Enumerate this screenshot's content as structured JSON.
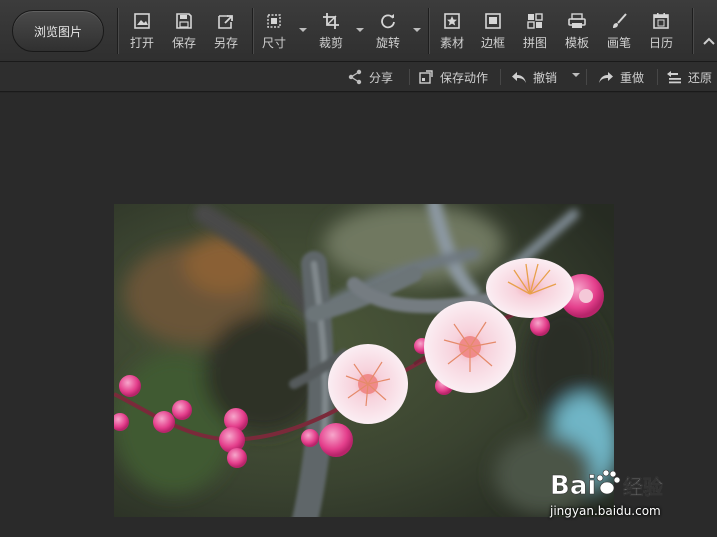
{
  "toolbar": {
    "browse_label": "浏览图片",
    "tools": [
      {
        "label": "打开",
        "icon": "open-icon"
      },
      {
        "label": "保存",
        "icon": "save-icon"
      },
      {
        "label": "另存",
        "icon": "save-as-icon"
      },
      {
        "label": "尺寸",
        "icon": "resize-icon"
      },
      {
        "label": "裁剪",
        "icon": "crop-icon"
      },
      {
        "label": "旋转",
        "icon": "rotate-icon"
      },
      {
        "label": "素材",
        "icon": "sticker-icon"
      },
      {
        "label": "边框",
        "icon": "frame-icon"
      },
      {
        "label": "拼图",
        "icon": "collage-icon"
      },
      {
        "label": "模板",
        "icon": "template-icon"
      },
      {
        "label": "画笔",
        "icon": "brush-icon"
      },
      {
        "label": "日历",
        "icon": "calendar-icon"
      }
    ]
  },
  "actionbar": {
    "share": "分享",
    "save_action": "保存动作",
    "undo": "撤销",
    "redo": "重做",
    "restore": "还原"
  },
  "watermark": {
    "brand": "Bai",
    "brand2": "du",
    "service": "经验",
    "url": "jingyan.baidu.com"
  },
  "colors": {
    "background": "#262626",
    "toolbar": "#383838",
    "text": "#d0d0d0",
    "blossom_pink": "#e43f8c",
    "blossom_white": "#fbeef3"
  }
}
